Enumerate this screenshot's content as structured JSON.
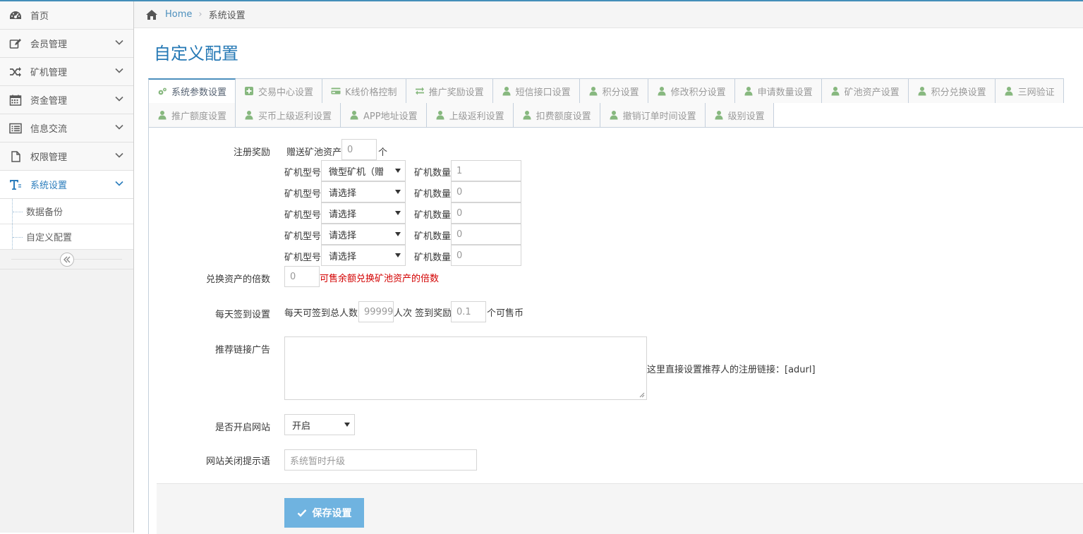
{
  "sidebar": {
    "items": [
      {
        "label": "首页",
        "icon": "dashboard-icon",
        "has_chevron": false
      },
      {
        "label": "会员管理",
        "icon": "edit-icon",
        "has_chevron": true
      },
      {
        "label": "矿机管理",
        "icon": "shuffle-icon",
        "has_chevron": true
      },
      {
        "label": "资金管理",
        "icon": "calendar-icon",
        "has_chevron": true
      },
      {
        "label": "信息交流",
        "icon": "list-alt-icon",
        "has_chevron": true
      },
      {
        "label": "权限管理",
        "icon": "file-icon",
        "has_chevron": true
      },
      {
        "label": "系统设置",
        "icon": "text-icon",
        "has_chevron": true,
        "active": true
      }
    ],
    "sub_items": [
      {
        "label": "数据备份"
      },
      {
        "label": "自定义配置"
      }
    ]
  },
  "breadcrumb": {
    "home": "Home",
    "current": "系统设置"
  },
  "page": {
    "title": "自定义配置"
  },
  "tabs": {
    "row1": [
      {
        "label": "系统参数设置",
        "icon": "cogs-icon",
        "active": true
      },
      {
        "label": "交易中心设置",
        "icon": "plus-square-icon"
      },
      {
        "label": "K线价格控制",
        "icon": "credit-card-icon"
      },
      {
        "label": "推广奖励设置",
        "icon": "exchange-icon"
      },
      {
        "label": "短信接口设置",
        "icon": "user-icon"
      },
      {
        "label": "积分设置",
        "icon": "user-icon"
      },
      {
        "label": "修改积分设置",
        "icon": "user-icon"
      },
      {
        "label": "申请数量设置",
        "icon": "user-icon"
      },
      {
        "label": "矿池资产设置",
        "icon": "user-icon"
      },
      {
        "label": "积分兑换设置",
        "icon": "user-icon"
      },
      {
        "label": "三网验证",
        "icon": "user-icon"
      }
    ],
    "row2": [
      {
        "label": "推广额度设置",
        "icon": "user-icon"
      },
      {
        "label": "买币上级返利设置",
        "icon": "user-icon"
      },
      {
        "label": "APP地址设置",
        "icon": "user-icon"
      },
      {
        "label": "上级返利设置",
        "icon": "user-icon"
      },
      {
        "label": "扣费额度设置",
        "icon": "user-icon"
      },
      {
        "label": "撤销订单时间设置",
        "icon": "user-icon"
      },
      {
        "label": "级别设置",
        "icon": "user-icon"
      }
    ]
  },
  "form": {
    "register_reward": {
      "label": "注册奖励",
      "gift_prefix": "赠送矿池资产",
      "gift_value": "0",
      "gift_suffix": "个",
      "machine_type_label": "矿机型号",
      "machine_count_label": "矿机数量",
      "rows": [
        {
          "type": "微型矿机（赠",
          "count": "1"
        },
        {
          "type": "请选择",
          "count": "0"
        },
        {
          "type": "请选择",
          "count": "0"
        },
        {
          "type": "请选择",
          "count": "0"
        },
        {
          "type": "请选择",
          "count": "0"
        }
      ]
    },
    "exchange_multiple": {
      "label": "兑换资产的倍数",
      "value": "0",
      "hint": "可售余额兑换矿池资产的倍数"
    },
    "daily_checkin": {
      "label": "每天签到设置",
      "prefix": "每天可签到总人数",
      "total_value": "99999",
      "mid": "人次 签到奖励",
      "reward_value": "0.1",
      "suffix": "个可售币"
    },
    "referral_ad": {
      "label": "推荐链接广告",
      "hint": "这里直接设置推荐人的注册链接：[adurl]"
    },
    "site_open": {
      "label": "是否开启网站",
      "value": "开启"
    },
    "site_close_msg": {
      "label": "网站关闭提示语",
      "placeholder": "系统暂时升级"
    },
    "save_label": "保存设置"
  },
  "colors": {
    "accent": "#2679b5",
    "link": "#4c8fbd",
    "button": "#6fb3e0",
    "tab_icon_green": "#87b87f",
    "hint_red": "#d30000"
  }
}
